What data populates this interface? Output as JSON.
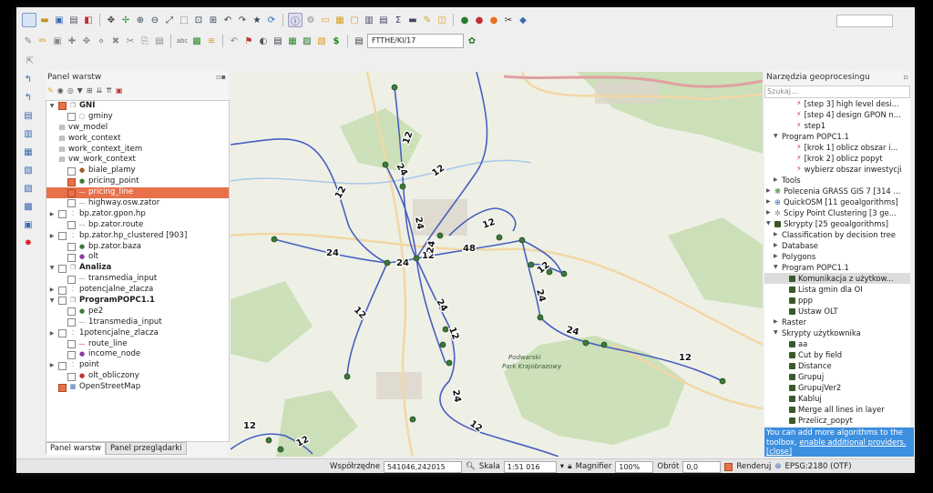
{
  "toolbar": {
    "route_field_value": "FTTHE/KI/17"
  },
  "layers_panel": {
    "title": "Panel warstw",
    "items": [
      {
        "label": "GNI",
        "bold": true,
        "indent": 0,
        "twisty": "▼",
        "checked": true,
        "symbol": "group"
      },
      {
        "label": "gminy",
        "indent": 1,
        "twisty": "",
        "checked": false,
        "symbol": "square"
      },
      {
        "label": "vw_model",
        "indent": 0,
        "twisty": "",
        "checked": null,
        "symbol": "table"
      },
      {
        "label": "work_context",
        "indent": 0,
        "twisty": "",
        "checked": null,
        "symbol": "table"
      },
      {
        "label": "work_context_item",
        "indent": 0,
        "twisty": "",
        "checked": null,
        "symbol": "table"
      },
      {
        "label": "vw_work_context",
        "indent": 0,
        "twisty": "",
        "checked": null,
        "symbol": "table"
      },
      {
        "label": "biale_plamy",
        "indent": 1,
        "twisty": "",
        "checked": false,
        "symbol": "dot-brown"
      },
      {
        "label": "pricing_point",
        "indent": 1,
        "twisty": "",
        "checked": true,
        "symbol": "dot-green"
      },
      {
        "label": "pricing_line",
        "indent": 1,
        "twisty": "",
        "checked": true,
        "symbol": "line-blue",
        "selected": true
      },
      {
        "label": "highway.osw.zator",
        "indent": 1,
        "twisty": "",
        "checked": false,
        "symbol": "line-grey"
      },
      {
        "label": "bp.zator.gpon.hp",
        "indent": 0,
        "twisty": "▶",
        "checked": false,
        "symbol": "dots"
      },
      {
        "label": "bp.zator.route",
        "indent": 1,
        "twisty": "",
        "checked": false,
        "symbol": "line-grey"
      },
      {
        "label": "bp.zator.hp_clustered [903]",
        "indent": 0,
        "twisty": "▶",
        "checked": false,
        "symbol": "dots"
      },
      {
        "label": "bp.zator.baza",
        "indent": 1,
        "twisty": "",
        "checked": false,
        "symbol": "dot-green"
      },
      {
        "label": "olt",
        "indent": 1,
        "twisty": "",
        "checked": false,
        "symbol": "dot-purple"
      },
      {
        "label": "Analiza",
        "bold": true,
        "indent": 0,
        "twisty": "▼",
        "checked": false,
        "symbol": "group"
      },
      {
        "label": "transmedia_input",
        "indent": 1,
        "twisty": "",
        "checked": false,
        "symbol": "line-grey"
      },
      {
        "label": "potencjalne_zlacza",
        "indent": 0,
        "twisty": "▶",
        "checked": false,
        "symbol": "dots"
      },
      {
        "label": "ProgramPOPC1.1",
        "bold": true,
        "indent": 0,
        "twisty": "▼",
        "checked": false,
        "symbol": "group"
      },
      {
        "label": "pe2",
        "indent": 1,
        "twisty": "",
        "checked": false,
        "symbol": "dot-green"
      },
      {
        "label": "1transmedia_input",
        "indent": 1,
        "twisty": "",
        "checked": false,
        "symbol": "line-grey"
      },
      {
        "label": "1potencjalne_zlacza",
        "indent": 0,
        "twisty": "▶",
        "checked": false,
        "symbol": "dots"
      },
      {
        "label": "route_line",
        "indent": 1,
        "twisty": "",
        "checked": false,
        "symbol": "line-red"
      },
      {
        "label": "income_node",
        "indent": 1,
        "twisty": "",
        "checked": false,
        "symbol": "dot-purple"
      },
      {
        "label": "point",
        "indent": 0,
        "twisty": "▶",
        "checked": false,
        "symbol": "dots"
      },
      {
        "label": "olt_obliczony",
        "indent": 1,
        "twisty": "",
        "checked": false,
        "symbol": "dot-red"
      },
      {
        "label": "OpenStreetMap",
        "indent": 0,
        "twisty": "",
        "checked": true,
        "symbol": "osm"
      }
    ],
    "tabs": [
      "Panel warstw",
      "Panel przeglądarki"
    ]
  },
  "processing_panel": {
    "title": "Narzędzia geoprocesingu",
    "search_placeholder": "Szukaj...",
    "items": [
      {
        "label": "[step 3] high level desi...",
        "indent": 3,
        "twisty": "",
        "icon": "model"
      },
      {
        "label": "[step 4] design GPON n...",
        "indent": 3,
        "twisty": "",
        "icon": "model"
      },
      {
        "label": "step1",
        "indent": 3,
        "twisty": "",
        "icon": "model"
      },
      {
        "label": "Program POPC1.1",
        "indent": 1,
        "twisty": "▼",
        "icon": ""
      },
      {
        "label": "[krok 1] oblicz obszar i...",
        "indent": 3,
        "twisty": "",
        "icon": "model"
      },
      {
        "label": "[krok 2] oblicz popyt",
        "indent": 3,
        "twisty": "",
        "icon": "model"
      },
      {
        "label": "wybierz obszar inwestycji",
        "indent": 3,
        "twisty": "",
        "icon": "model"
      },
      {
        "label": "Tools",
        "indent": 1,
        "twisty": "▶",
        "icon": ""
      },
      {
        "label": "Polecenia GRASS GIS 7 [314 ...",
        "indent": 0,
        "twisty": "▶",
        "icon": "grass"
      },
      {
        "label": "QuickOSM [11 geoalgorithms]",
        "indent": 0,
        "twisty": "▶",
        "icon": "qosm"
      },
      {
        "label": "Scipy Point Clustering [3 ge...",
        "indent": 0,
        "twisty": "▶",
        "icon": "scipy"
      },
      {
        "label": "Skrypty [25 geoalgorithms]",
        "indent": 0,
        "twisty": "▼",
        "icon": "script"
      },
      {
        "label": "Classification by decision tree",
        "indent": 1,
        "twisty": "▶",
        "icon": ""
      },
      {
        "label": "Database",
        "indent": 1,
        "twisty": "▶",
        "icon": ""
      },
      {
        "label": "Polygons",
        "indent": 1,
        "twisty": "▶",
        "icon": ""
      },
      {
        "label": "Program POPC1.1",
        "indent": 1,
        "twisty": "▼",
        "icon": ""
      },
      {
        "label": "Komunikacja z użytkow...",
        "indent": 2,
        "twisty": "",
        "icon": "script",
        "selected": true
      },
      {
        "label": "Lista gmin dla OI",
        "indent": 2,
        "twisty": "",
        "icon": "script"
      },
      {
        "label": "ppp",
        "indent": 2,
        "twisty": "",
        "icon": "script"
      },
      {
        "label": "Ustaw OLT",
        "indent": 2,
        "twisty": "",
        "icon": "script"
      },
      {
        "label": "Raster",
        "indent": 1,
        "twisty": "▶",
        "icon": ""
      },
      {
        "label": "Skrypty użytkownika",
        "indent": 1,
        "twisty": "▼",
        "icon": ""
      },
      {
        "label": "aa",
        "indent": 2,
        "twisty": "",
        "icon": "script"
      },
      {
        "label": "Cut by field",
        "indent": 2,
        "twisty": "",
        "icon": "script"
      },
      {
        "label": "Distance",
        "indent": 2,
        "twisty": "",
        "icon": "script"
      },
      {
        "label": "Grupuj",
        "indent": 2,
        "twisty": "",
        "icon": "script"
      },
      {
        "label": "GrupujVer2",
        "indent": 2,
        "twisty": "",
        "icon": "script"
      },
      {
        "label": "Kabluj",
        "indent": 2,
        "twisty": "",
        "icon": "script"
      },
      {
        "label": "Merge all lines in layer",
        "indent": 2,
        "twisty": "",
        "icon": "script"
      },
      {
        "label": "Przelicz_popyt",
        "indent": 2,
        "twisty": "",
        "icon": "script"
      }
    ],
    "message_text": "You can add more algorithms to the toolbox,",
    "message_link": "enable additional providers.",
    "message_close": "[close]"
  },
  "map": {
    "line_labels": [
      "12",
      "12",
      "12",
      "24",
      "24",
      "24",
      "12",
      "12",
      "24",
      "24",
      "48",
      "12",
      "24",
      "24",
      "24",
      "12",
      "12",
      "12",
      "24",
      "12",
      "12",
      "12"
    ],
    "place_labels": [
      "Podwarski",
      "Park Krajobrazowy"
    ]
  },
  "status_bar": {
    "coord_label": "Współrzędne",
    "coord_value": "541046,242015",
    "scale_label": "Skala",
    "scale_value": "1:51 016",
    "magnifier_label": "Magnifier",
    "magnifier_value": "100%",
    "rotation_label": "Obrót",
    "rotation_value": "0,0",
    "render_label": "Renderuj",
    "epsg_label": "EPSG:2180 (OTF)"
  },
  "colors": {
    "selection": "#e8704a",
    "route_line": "#4a5fc0",
    "node_point": "#3d7a3a",
    "message_bg": "#3d8fe0"
  }
}
